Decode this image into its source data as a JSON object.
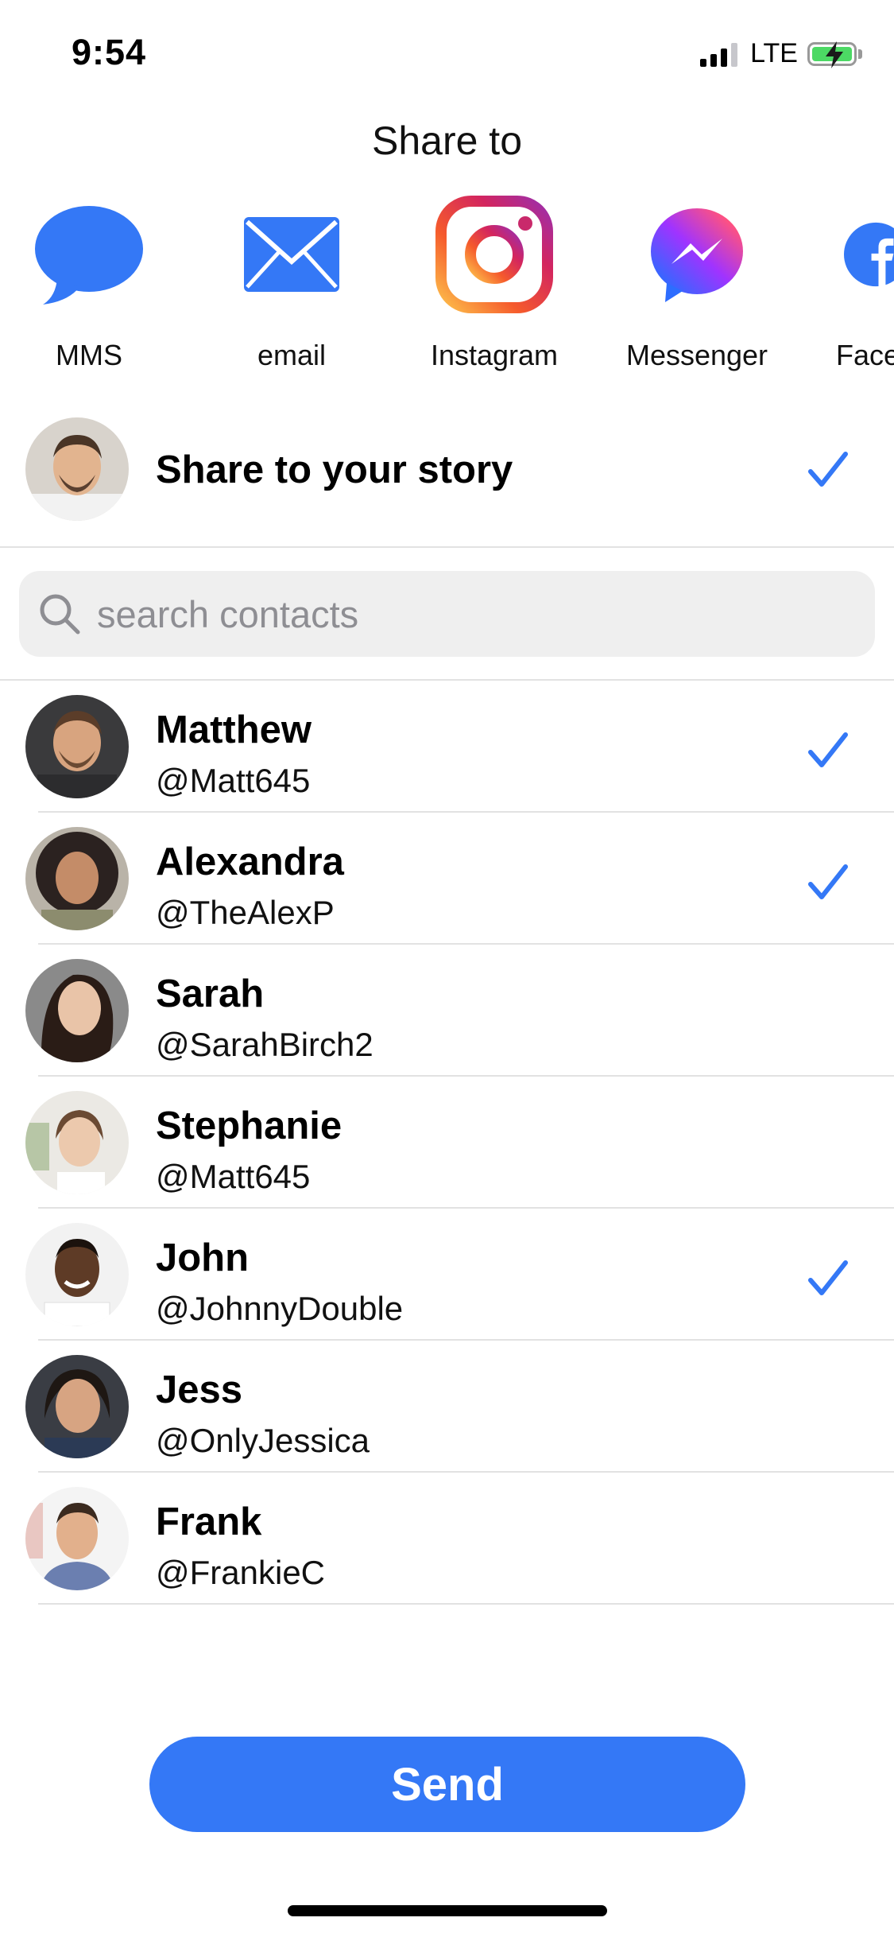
{
  "status": {
    "time": "9:54",
    "network": "LTE"
  },
  "header": {
    "title": "Share to"
  },
  "apps": [
    {
      "label": "MMS",
      "icon": "speech-bubble-icon"
    },
    {
      "label": "email",
      "icon": "envelope-icon"
    },
    {
      "label": "Instagram",
      "icon": "instagram-icon"
    },
    {
      "label": "Messenger",
      "icon": "messenger-icon"
    },
    {
      "label": "Face",
      "icon": "facebook-icon"
    }
  ],
  "story": {
    "label": "Share to your story",
    "selected": true
  },
  "search": {
    "placeholder": "search contacts",
    "value": ""
  },
  "contacts": [
    {
      "name": "Matthew",
      "handle": "@Matt645",
      "selected": true
    },
    {
      "name": "Alexandra",
      "handle": "@TheAlexP",
      "selected": true
    },
    {
      "name": "Sarah",
      "handle": "@SarahBirch2",
      "selected": false
    },
    {
      "name": "Stephanie",
      "handle": "@Matt645",
      "selected": false
    },
    {
      "name": "John",
      "handle": "@JohnnyDouble",
      "selected": true
    },
    {
      "name": "Jess",
      "handle": "@OnlyJessica",
      "selected": false
    },
    {
      "name": "Frank",
      "handle": "@FrankieC",
      "selected": false
    }
  ],
  "actions": {
    "send_label": "Send"
  },
  "colors": {
    "accent": "#3478f6",
    "divider": "#e2e2e2",
    "search_bg": "#efefef"
  }
}
